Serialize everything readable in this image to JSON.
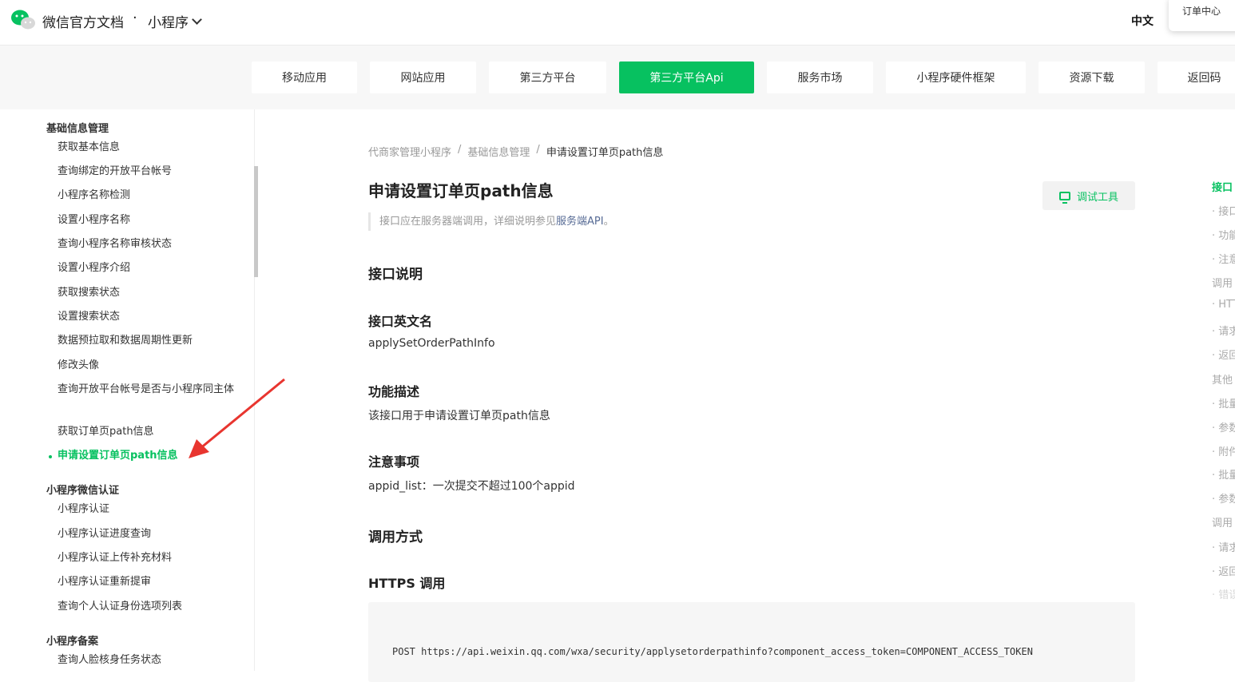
{
  "header": {
    "site_title": "微信官方文档",
    "separator": "·",
    "section": "小程序",
    "language": "中文",
    "popover_text": "订单中心"
  },
  "nav": [
    {
      "label": "移动应用",
      "active": false
    },
    {
      "label": "网站应用",
      "active": false
    },
    {
      "label": "第三方平台",
      "active": false
    },
    {
      "label": "第三方平台Api",
      "active": true
    },
    {
      "label": "服务市场",
      "active": false
    },
    {
      "label": "小程序硬件框架",
      "active": false
    },
    {
      "label": "资源下载",
      "active": false
    },
    {
      "label": "返回码",
      "active": false
    }
  ],
  "sidebar": {
    "group1": "基础信息管理",
    "group1_items": [
      "获取基本信息",
      "查询绑定的开放平台帐号",
      "小程序名称检测",
      "设置小程序名称",
      "查询小程序名称审核状态",
      "设置小程序介绍",
      "获取搜索状态",
      "设置搜索状态",
      "数据预拉取和数据周期性更新",
      "修改头像",
      "查询开放平台帐号是否与小程序同主体",
      "获取订单页path信息",
      "申请设置订单页path信息"
    ],
    "group2": "小程序微信认证",
    "group2_items": [
      "小程序认证",
      "小程序认证进度查询",
      "小程序认证上传补充材料",
      "小程序认证重新提审",
      "查询个人认证身份选项列表"
    ],
    "group3": "小程序备案",
    "group3_items": [
      "查询人脸核身任务状态"
    ]
  },
  "breadcrumb": [
    "代商家管理小程序",
    "/",
    "基础信息管理",
    "/",
    "申请设置订单页path信息"
  ],
  "content": {
    "title": "申请设置订单页path信息",
    "debug_button": "调试工具",
    "note_prefix": "接口应在服务器端调用，详细说明参见",
    "note_link": "服务端API",
    "note_suffix": "。",
    "h_api_desc": "接口说明",
    "h_api_name": "接口英文名",
    "api_name": "applySetOrderPathInfo",
    "h_func": "功能描述",
    "func_desc": "该接口用于申请设置订单页path信息",
    "h_notice": "注意事项",
    "notice": "appid_list：一次提交不超过100个appid",
    "h_call": "调用方式",
    "h_https": "HTTPS 调用",
    "code": "POST https://api.weixin.qq.com/wxa/security/applysetorderpathinfo?component_access_token=COMPONENT_ACCESS_TOKEN"
  },
  "toc": [
    "接口",
    "· 接口",
    "· 功能",
    "· 注意",
    "调用",
    "· HTT",
    "· 请求",
    "· 返回",
    "其他",
    "· 批量",
    "· 参数",
    "· 附件",
    "· 批量",
    "· 参数",
    "调用",
    "· 请求",
    "· 返回",
    "· 错误"
  ]
}
